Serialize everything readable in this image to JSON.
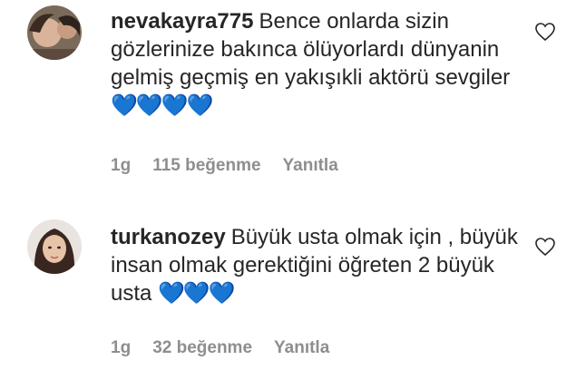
{
  "comments": [
    {
      "username": "nevakayra775",
      "text": "Bence onlarda sizin gözlerinize bakınca ölüyorlardı dünyanin gelmiş geçmiş en yakışıkli aktörü sevgiler",
      "emoji": "💙💙💙💙",
      "time": "1g",
      "likes": "115 beğenme",
      "reply": "Yanıtla"
    },
    {
      "username": "turkanozey",
      "text": "Büyük usta olmak için , büyük insan olmak gerektiğini öğreten 2 büyük usta",
      "emoji": "💙💙💙",
      "time": "1g",
      "likes": "32 beğenme",
      "reply": "Yanıtla"
    }
  ],
  "colors": {
    "text": "#262626",
    "meta": "#8e8e8e",
    "heart_emoji": "#3897f0"
  },
  "icons": {
    "like": "heart-outline-icon"
  }
}
